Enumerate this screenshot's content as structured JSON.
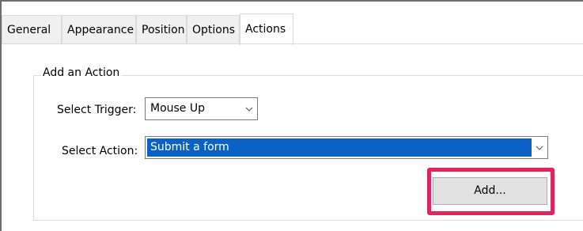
{
  "tabs": [
    {
      "label": "General",
      "active": false
    },
    {
      "label": "Appearance",
      "active": false
    },
    {
      "label": "Position",
      "active": false
    },
    {
      "label": "Options",
      "active": false
    },
    {
      "label": "Actions",
      "active": true
    }
  ],
  "group": {
    "title": "Add an Action"
  },
  "trigger": {
    "label": "Select Trigger:",
    "value": "Mouse Up"
  },
  "action": {
    "label": "Select Action:",
    "value": "Submit a form"
  },
  "add_button": {
    "label": "Add..."
  },
  "colors": {
    "selection": "#0a63c4",
    "callout": "#e0245e"
  }
}
